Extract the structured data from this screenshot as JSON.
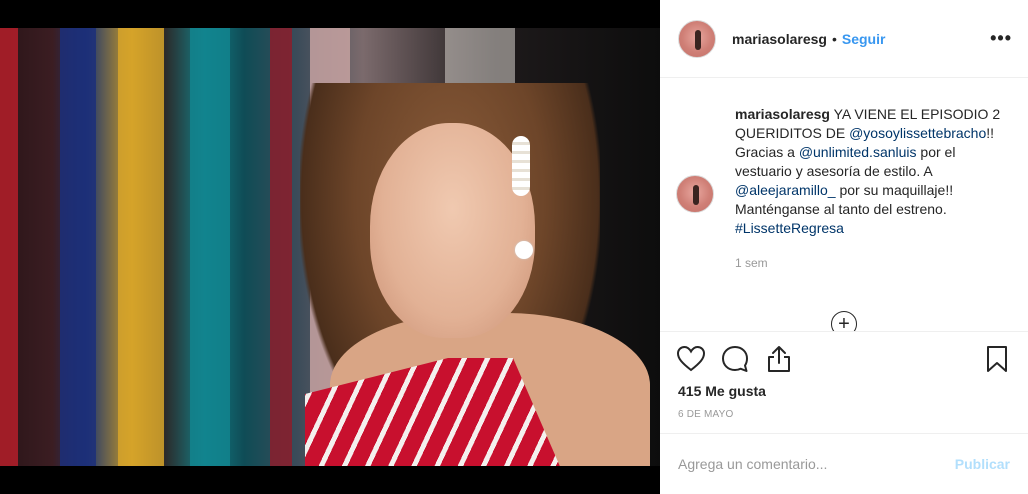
{
  "post": {
    "username": "mariasolaresg",
    "separator": "•",
    "follow_label": "Seguir",
    "more_label": "•••"
  },
  "caption": {
    "username": "mariasolaresg",
    "text_1": " YA VIENE EL EPISODIO 2 QUERIDITOS DE ",
    "mention_1": "@yosoylissettebracho",
    "text_2": "!! Gracias a ",
    "mention_2": "@unlimited.sanluis",
    "text_3": " por el vestuario y asesoría de estilo. A ",
    "mention_3": "@aleejaramillo_",
    "text_4": " por su maquillaje!! Manténganse al tanto del estreno. ",
    "hashtag": "#LissetteRegresa",
    "time": "1 sem"
  },
  "load_more_label": "+",
  "actions": {
    "like_icon": "heart-icon",
    "comment_icon": "comment-icon",
    "share_icon": "share-icon",
    "save_icon": "bookmark-icon"
  },
  "likes_text": "415 Me gusta",
  "date_text": "6 DE MAYO",
  "comment_bar": {
    "placeholder": "Agrega un comentario...",
    "publish_label": "Publicar"
  },
  "colors": {
    "link": "#3897f0",
    "mention": "#003569",
    "publish_disabled": "#b2dffc",
    "meta": "#999999"
  }
}
